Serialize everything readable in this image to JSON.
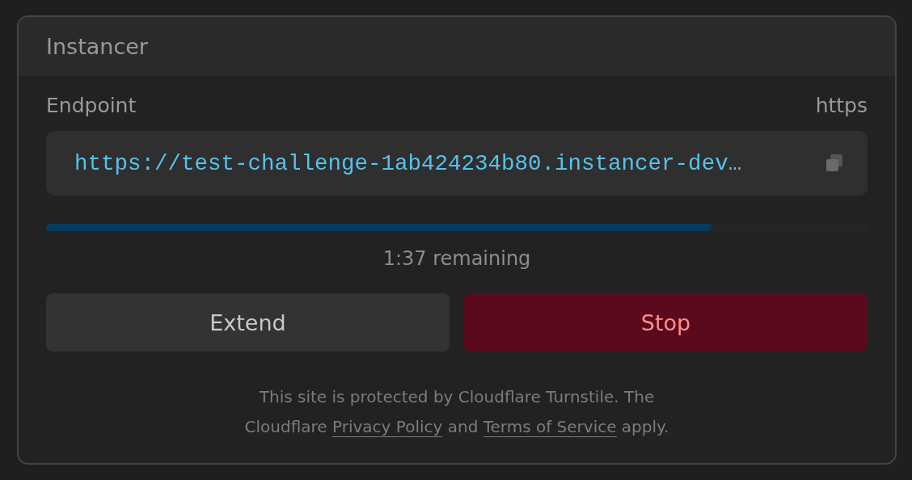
{
  "panel": {
    "title": "Instancer"
  },
  "endpoint": {
    "label": "Endpoint",
    "protocol": "https",
    "url": "https://test-challenge-1ab424234b80.instancer-dev…"
  },
  "timer": {
    "level": 0.81,
    "reading": "1:37 remaining"
  },
  "buttons": [
    {
      "label": "Extend",
      "kind": "neutral"
    },
    {
      "label": "Stop",
      "kind": "danger"
    }
  ],
  "notice": [
    {
      "kind": "text",
      "text": "This site is protected by Cloudflare Turnstile. The Cloudflare "
    },
    {
      "kind": "link",
      "text": "Privacy Policy"
    },
    {
      "kind": "text",
      "text": " and "
    },
    {
      "kind": "link",
      "text": "Terms of Service"
    },
    {
      "kind": "text",
      "text": " apply."
    }
  ]
}
